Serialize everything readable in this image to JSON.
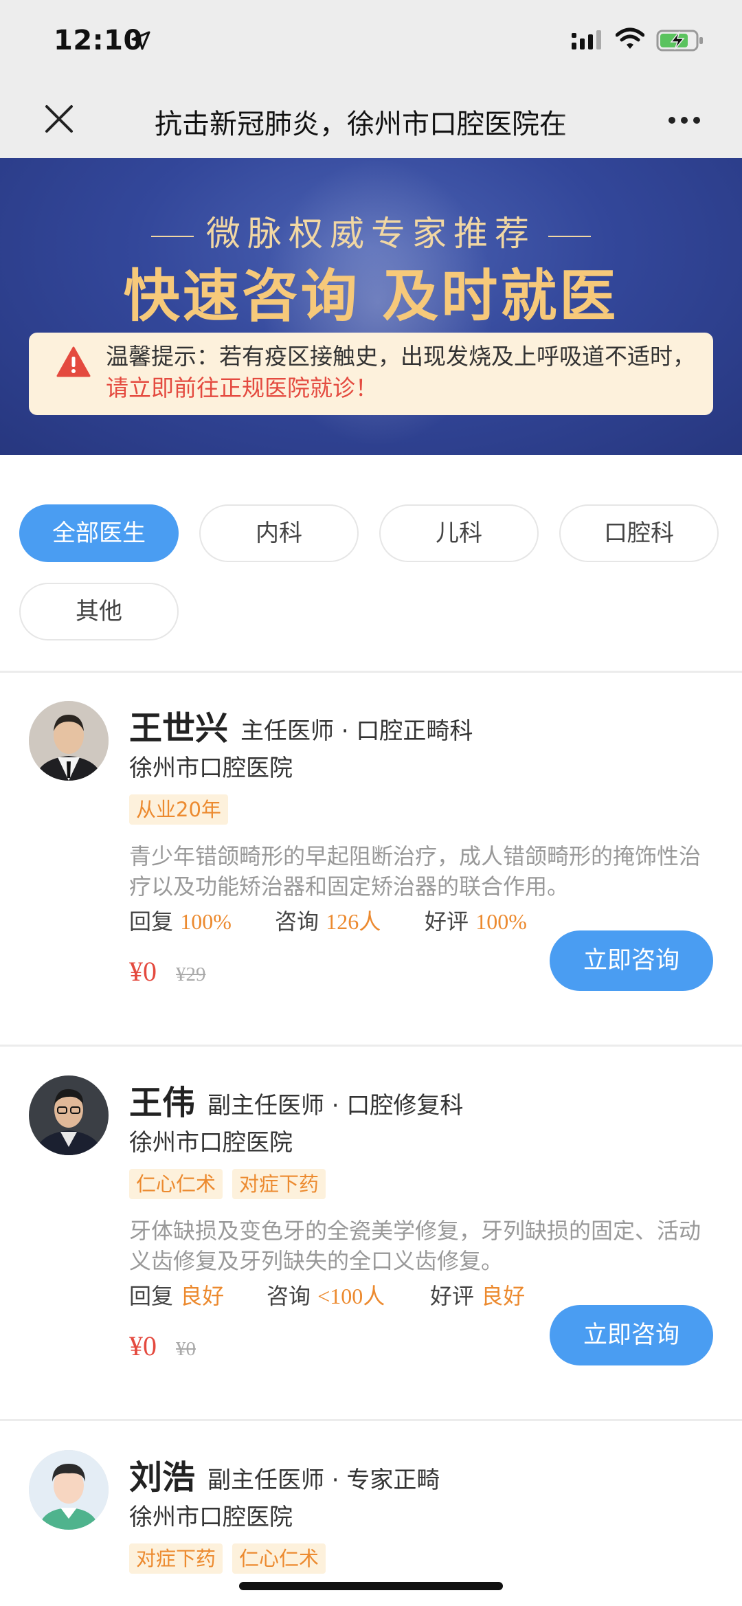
{
  "status": {
    "time": "12:10"
  },
  "nav": {
    "title": "抗击新冠肺炎，徐州市口腔医院在"
  },
  "banner": {
    "subtitle": "微脉权威专家推荐",
    "headline": "快速咨询 及时就医",
    "notice_prefix": "温馨提示：若有疫区接触史，出现发烧及上呼吸道不适时，",
    "notice_highlight": "请立即前往正规医院就诊！",
    "highlight_color": "#e44a3f"
  },
  "filters": {
    "active_color": "#4a9df2",
    "items": [
      "全部医生",
      "内科",
      "儿科",
      "口腔科",
      "其他"
    ],
    "selected": "全部医生"
  },
  "doctors": [
    {
      "name": "王世兴",
      "title": "主任医师 · 口腔正畸科",
      "hospital": "徐州市口腔医院",
      "tags": [
        "从业20年"
      ],
      "desc": "青少年错颌畸形的早起阻断治疗，成人错颌畸形的掩饰性治疗以及功能矫治器和固定矫治器的联合作用。",
      "reply_label": "回复",
      "reply": "100%",
      "consult_label": "咨询",
      "consult": "126人",
      "rating_label": "好评",
      "rating": "100%",
      "price": "¥0",
      "orig_price": "¥29",
      "button": "立即咨询"
    },
    {
      "name": "王伟",
      "title": "副主任医师 · 口腔修复科",
      "hospital": "徐州市口腔医院",
      "tags": [
        "仁心仁术",
        "对症下药"
      ],
      "desc": "牙体缺损及变色牙的全瓷美学修复，牙列缺损的固定、活动义齿修复及牙列缺失的全口义齿修复。",
      "reply_label": "回复",
      "reply": "良好",
      "consult_label": "咨询",
      "consult": "<100人",
      "rating_label": "好评",
      "rating": "良好",
      "price": "¥0",
      "orig_price": "¥0",
      "button": "立即咨询"
    },
    {
      "name": "刘浩",
      "title": "副主任医师 · 专家正畸",
      "hospital": "徐州市口腔医院",
      "tags": [
        "对症下药",
        "仁心仁术"
      ]
    }
  ]
}
